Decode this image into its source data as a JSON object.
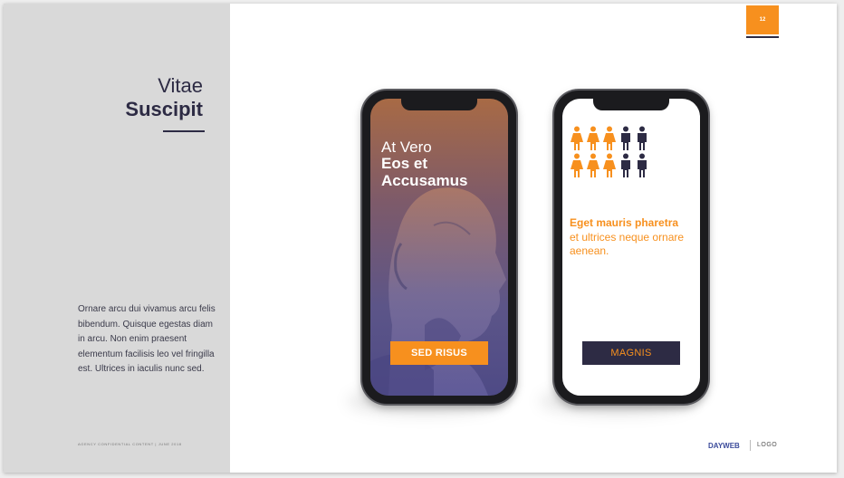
{
  "left_panel": {
    "title_light": "Vitae",
    "title_bold": "Suscipit",
    "body": "Ornare arcu dui vivamus arcu felis bibendum. Quisque egestas diam in arcu. Non enim praesent elementum facilisis leo vel fringilla est. Ultrices in iaculis nunc sed.",
    "footer_note": "AGENCY CONFIDENTIAL CONTENT | JUNE 2018"
  },
  "page_number": "12",
  "phone_1": {
    "headline_light": "At Vero",
    "headline_bold": "Eos et Accusamus",
    "button_label": "SED RISUS"
  },
  "phone_2": {
    "stat_bold": "Eget mauris pharetra",
    "stat_light": "et ultrices neque ornare aenean.",
    "button_label": "MAGNIS",
    "people_icons": [
      "female",
      "female",
      "female",
      "male",
      "male",
      "female",
      "female",
      "female",
      "male",
      "male"
    ]
  },
  "footer": {
    "brand": "DAYWEB",
    "logo": "LOGO"
  },
  "colors": {
    "accent": "#f7901e",
    "navy": "#2d2b44",
    "panel": "#d9d9d9"
  }
}
